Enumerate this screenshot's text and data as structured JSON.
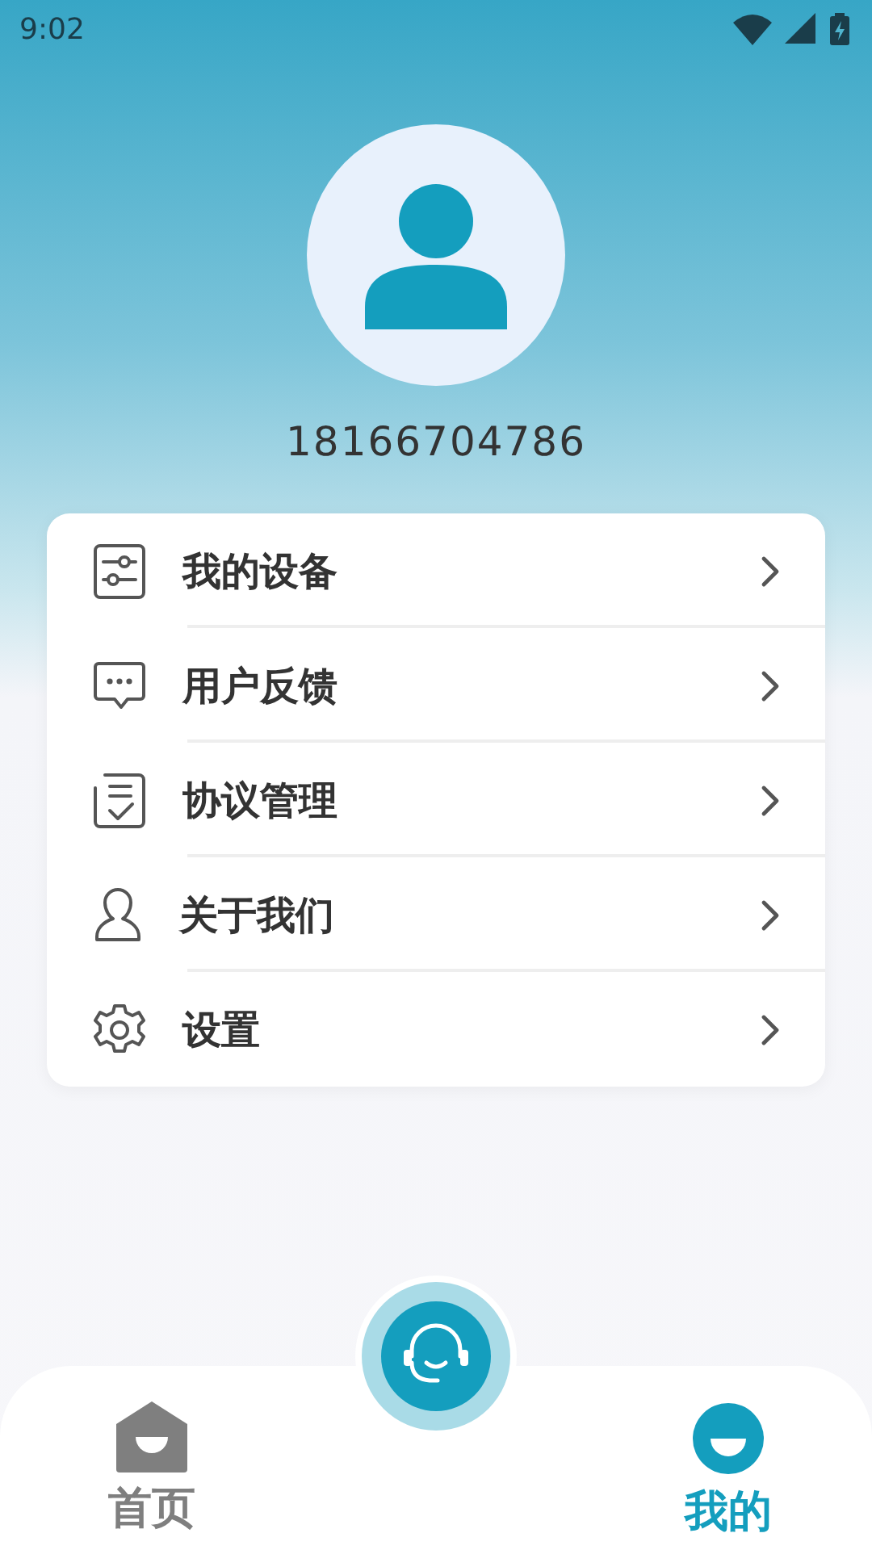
{
  "status_bar": {
    "time": "9:02"
  },
  "profile": {
    "phone": "18166704786"
  },
  "menu": [
    {
      "label": "我的设备"
    },
    {
      "label": "用户反馈"
    },
    {
      "label": "协议管理"
    },
    {
      "label": "关于我们"
    },
    {
      "label": "设置"
    }
  ],
  "tabs": [
    {
      "label": "首页",
      "selected": false
    },
    {
      "label": "我的",
      "selected": true
    }
  ]
}
